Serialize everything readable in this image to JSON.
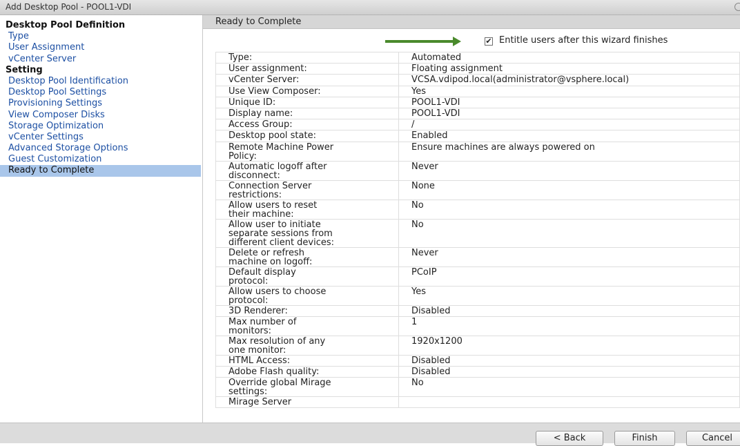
{
  "window": {
    "title": "Add Desktop Pool - POOL1-VDI"
  },
  "sidebar": {
    "sections": [
      {
        "heading": "Desktop Pool Definition",
        "items": [
          "Type",
          "User Assignment",
          "vCenter Server"
        ]
      },
      {
        "heading": "Setting",
        "items": [
          "Desktop Pool Identification",
          "Desktop Pool Settings",
          "Provisioning Settings",
          "View Composer Disks",
          "Storage Optimization",
          "vCenter Settings",
          "Advanced Storage Options",
          "Guest Customization",
          "Ready to Complete"
        ]
      }
    ],
    "active_item": "Ready to Complete"
  },
  "main": {
    "step_title": "Ready to Complete",
    "entitle": {
      "label": "Entitle users after this wizard finishes",
      "checked": true,
      "check_glyph": "✔"
    },
    "summary_rows": [
      {
        "label": "Type:",
        "value": "Automated"
      },
      {
        "label": "User assignment:",
        "value": "Floating assignment"
      },
      {
        "label": "vCenter Server:",
        "value": "VCSA.vdipod.local(administrator@vsphere.local)"
      },
      {
        "label": "Use View Composer:",
        "value": "Yes"
      },
      {
        "label": "Unique ID:",
        "value": "POOL1-VDI"
      },
      {
        "label": "Display name:",
        "value": "POOL1-VDI"
      },
      {
        "label": "Access Group:",
        "value": "/"
      },
      {
        "label": "Desktop pool state:",
        "value": "Enabled"
      },
      {
        "label": "Remote Machine Power\nPolicy:",
        "value": "Ensure machines are always powered on"
      },
      {
        "label": "Automatic logoff after\ndisconnect:",
        "value": "Never"
      },
      {
        "label": "Connection Server\nrestrictions:",
        "value": "None"
      },
      {
        "label": "Allow users to reset\ntheir machine:",
        "value": "No"
      },
      {
        "label": "Allow user to initiate\nseparate sessions from\ndifferent client devices:",
        "value": "No"
      },
      {
        "label": "Delete or refresh\nmachine on logoff:",
        "value": "Never"
      },
      {
        "label": "Default display\nprotocol:",
        "value": "PCoIP"
      },
      {
        "label": "Allow users to choose\nprotocol:",
        "value": "Yes"
      },
      {
        "label": "3D Renderer:",
        "value": "Disabled"
      },
      {
        "label": "Max number of\nmonitors:",
        "value": "1"
      },
      {
        "label": "Max resolution of any\none monitor:",
        "value": "1920x1200"
      },
      {
        "label": "HTML Access:",
        "value": "Disabled"
      },
      {
        "label": "Adobe Flash quality:",
        "value": "Disabled"
      },
      {
        "label": "Override global Mirage\nsettings:",
        "value": "No"
      },
      {
        "label": "Mirage Server",
        "value": ""
      }
    ]
  },
  "footer": {
    "back_label": "< Back",
    "finish_label": "Finish",
    "cancel_label": "Cancel"
  },
  "colors": {
    "accent_arrow": "#4a8a2c",
    "link": "#1c4fa3",
    "active_bg": "#a9c6ea"
  }
}
